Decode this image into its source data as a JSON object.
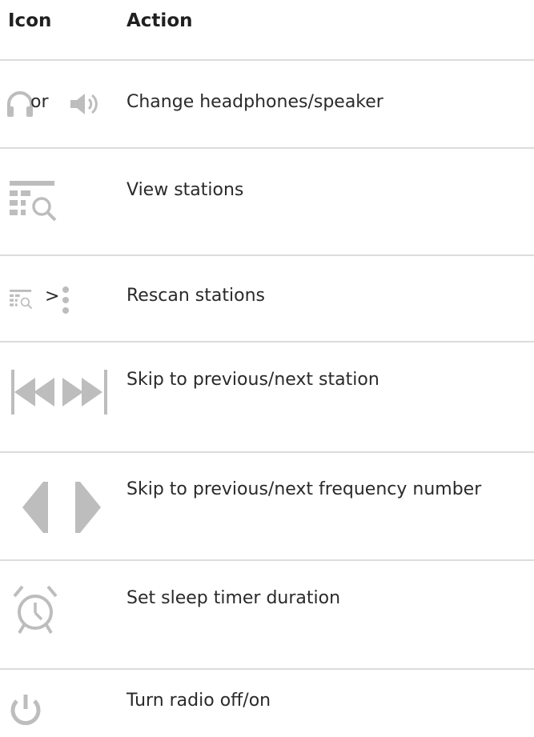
{
  "header": {
    "icon_col": "Icon",
    "action_col": "Action"
  },
  "rows": [
    {
      "icons": [
        "headphones-icon",
        "speaker-icon"
      ],
      "joiner": "or",
      "action": "Change headphones/speaker"
    },
    {
      "icons": [
        "station-list-icon"
      ],
      "action": "View stations"
    },
    {
      "icons": [
        "station-list-icon",
        "more-vert-icon"
      ],
      "joiner": ">",
      "action": "Rescan stations"
    },
    {
      "icons": [
        "skip-previous-icon",
        "skip-next-icon"
      ],
      "action": "Skip to previous/next station"
    },
    {
      "icons": [
        "arrow-left-icon",
        "arrow-right-icon"
      ],
      "action": "Skip to previous/next frequency number"
    },
    {
      "icons": [
        "alarm-clock-icon"
      ],
      "action": "Set sleep timer duration"
    },
    {
      "icons": [
        "power-icon"
      ],
      "action": "Turn radio off/on"
    }
  ],
  "colors": {
    "icon_gray": "#bdbdbd",
    "divider": "#dcdcdc",
    "text": "#2a2a2a"
  }
}
